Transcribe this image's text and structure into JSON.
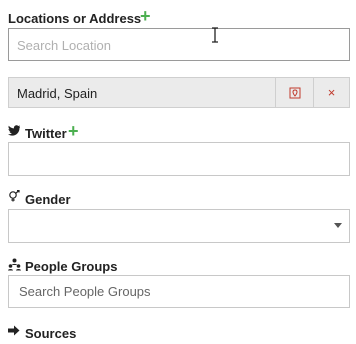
{
  "locations": {
    "label": "Locations or Address",
    "placeholder": "Search Location",
    "selected": [
      {
        "text": "Madrid, Spain",
        "remove": "×"
      }
    ]
  },
  "twitter": {
    "label": "Twitter",
    "value": ""
  },
  "gender": {
    "label": "Gender",
    "selected_value": ""
  },
  "people_groups": {
    "label": "People Groups",
    "placeholder": "Search People Groups"
  },
  "sources": {
    "label": "Sources"
  },
  "icons": {
    "add": "plus-icon",
    "twitter": "twitter-icon",
    "gender": "gender-icon",
    "people": "people-group-icon",
    "sources": "arrow-right-icon",
    "dropdown": "chevron-down-icon",
    "map": "map-pin-icon",
    "cursor": "text-cursor-icon"
  },
  "colors": {
    "add": "#4caf50",
    "remove": "#c0392b",
    "chip_bg": "#ebebeb"
  }
}
